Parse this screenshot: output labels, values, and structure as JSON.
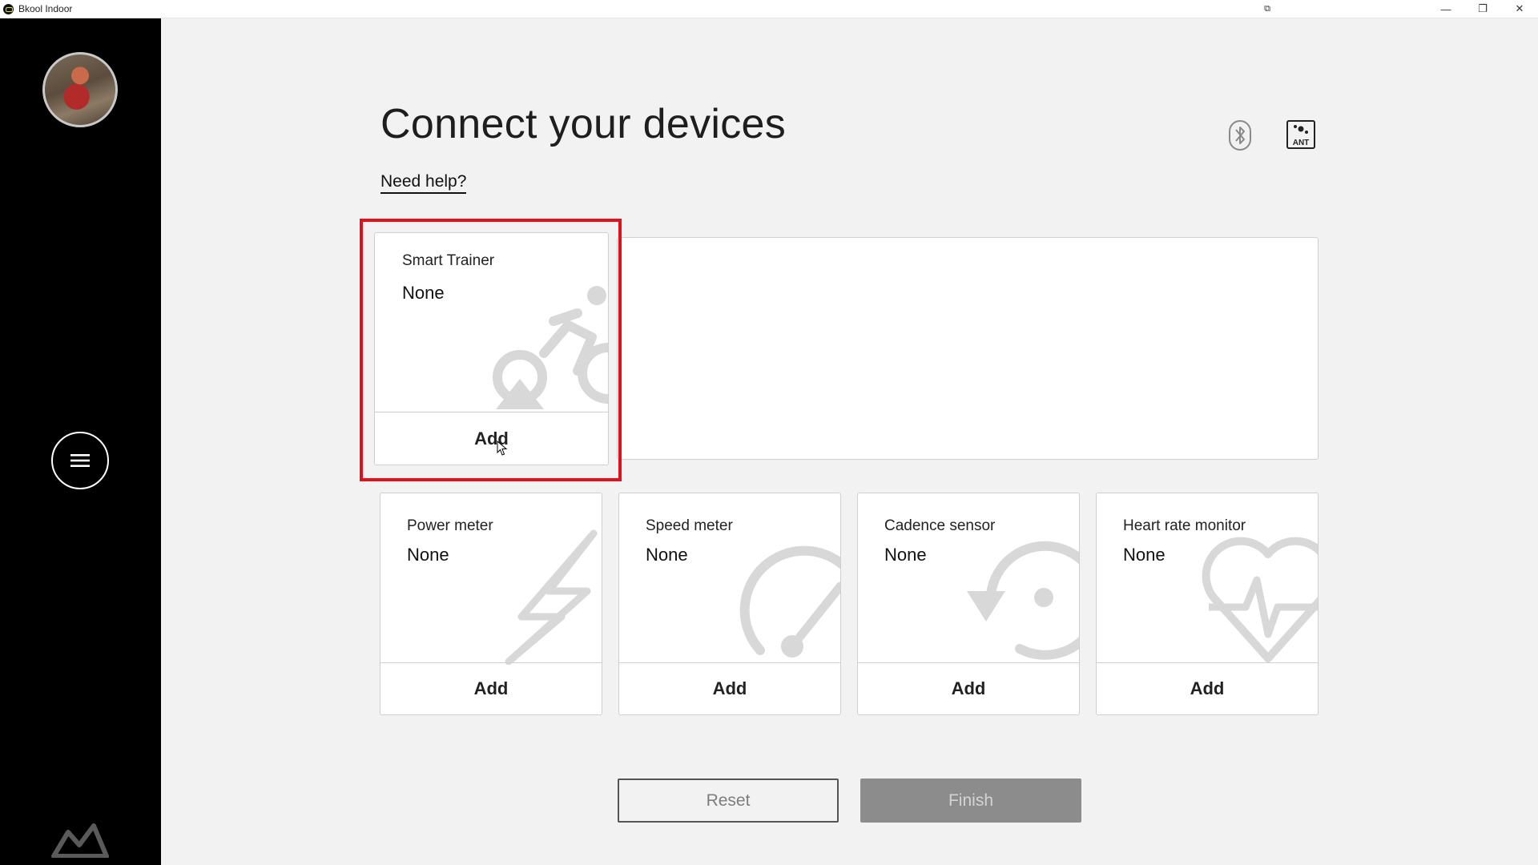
{
  "window": {
    "title": "Bkool Indoor",
    "controls": {
      "extra": "⧉",
      "minimize": "—",
      "restore": "❐",
      "close": "✕"
    }
  },
  "header": {
    "title": "Connect your devices",
    "help_link": "Need help?"
  },
  "devices": {
    "smart_trainer": {
      "title": "Smart Trainer",
      "value": "None",
      "action": "Add"
    },
    "power_meter": {
      "title": "Power meter",
      "value": "None",
      "action": "Add"
    },
    "speed_meter": {
      "title": "Speed meter",
      "value": "None",
      "action": "Add"
    },
    "cadence_sensor": {
      "title": "Cadence sensor",
      "value": "None",
      "action": "Add"
    },
    "heart_rate_monitor": {
      "title": "Heart rate monitor",
      "value": "None",
      "action": "Add"
    }
  },
  "actions": {
    "reset": "Reset",
    "finish": "Finish"
  },
  "icons": {
    "bluetooth": "bluetooth-icon",
    "ant": "ant-icon",
    "menu": "hamburger-menu-icon",
    "logo": "bkool-logo-icon"
  },
  "colors": {
    "sidebar": "#000000",
    "background": "#f2f2f2",
    "highlight": "#e0111c",
    "finish_disabled": "#8c8c8c"
  }
}
